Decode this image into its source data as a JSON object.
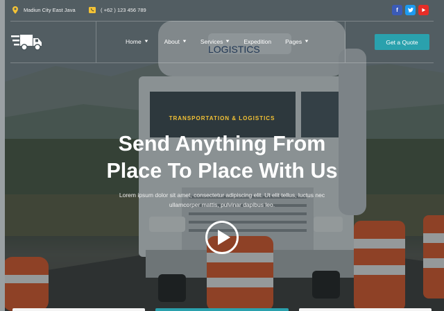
{
  "topbar": {
    "address": "Madiun City East Java",
    "phone": "( +62 ) 123 456 789",
    "address_icon": "map-pin-icon",
    "phone_icon": "phone-icon",
    "socials": [
      {
        "name": "facebook",
        "glyph": "f",
        "color": "#3b5bb7"
      },
      {
        "name": "twitter",
        "glyph": "t",
        "color": "#1d9bf0"
      },
      {
        "name": "youtube",
        "glyph": "▶",
        "color": "#e52d27"
      }
    ]
  },
  "nav": {
    "logo_icon": "delivery-truck-icon",
    "items": [
      {
        "label": "Home",
        "has_dropdown": true
      },
      {
        "label": "About",
        "has_dropdown": true
      },
      {
        "label": "Services",
        "has_dropdown": true
      },
      {
        "label": "Expedition",
        "has_dropdown": false
      },
      {
        "label": "Pages",
        "has_dropdown": true
      }
    ],
    "cta_label": "Get a Quote"
  },
  "hero": {
    "tagline": "TRANSPORTATION & LOGISTICS",
    "headline_line1": "Send Anything From",
    "headline_line2": "Place To Place With Us",
    "description_line1": "Lorem ipsum dolor sit amet, consectetur adipiscing elit. Ut elit tellus, luctus nec",
    "description_line2": "ullamcorper mattis, pulvinar dapibus leo.",
    "truck_text": "LOGISTICS",
    "play_icon": "play-icon"
  },
  "colors": {
    "accent": "#2aa1ad",
    "tagline": "#f3c235",
    "icon_yellow": "#f3c235"
  }
}
